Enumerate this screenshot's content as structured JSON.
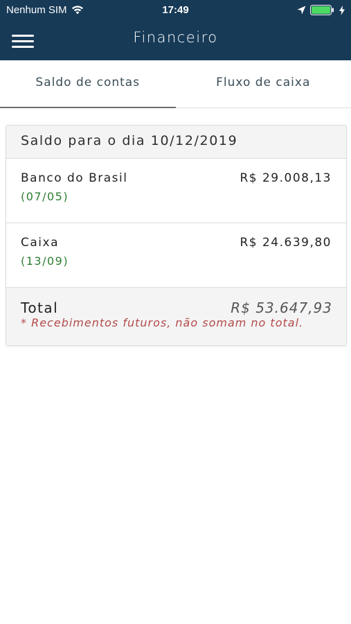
{
  "status_bar": {
    "carrier": "Nenhum SIM",
    "time": "17:49",
    "icons": [
      "wifi-icon",
      "location-arrow-icon",
      "battery-icon",
      "charging-bolt-icon"
    ]
  },
  "nav": {
    "title": "Financeiro",
    "menu_icon": "hamburger-menu-icon"
  },
  "tabs": [
    {
      "label": "Saldo de contas",
      "active": true
    },
    {
      "label": "Fluxo de caixa",
      "active": false
    }
  ],
  "balance": {
    "header": "Saldo para o dia 10/12/2019",
    "accounts": [
      {
        "name": "Banco do Brasil",
        "date": "(07/05)",
        "value": "R$ 29.008,13"
      },
      {
        "name": "Caixa",
        "date": "(13/09)",
        "value": "R$ 24.639,80"
      }
    ],
    "total_label": "Total",
    "total_value": "R$ 53.647,93",
    "note": "* Recebimentos futuros, não somam no total."
  },
  "colors": {
    "header_bg": "#173a57",
    "date_green": "#2e7d32",
    "note_red": "#b34a4a",
    "battery_green": "#4cd964"
  }
}
